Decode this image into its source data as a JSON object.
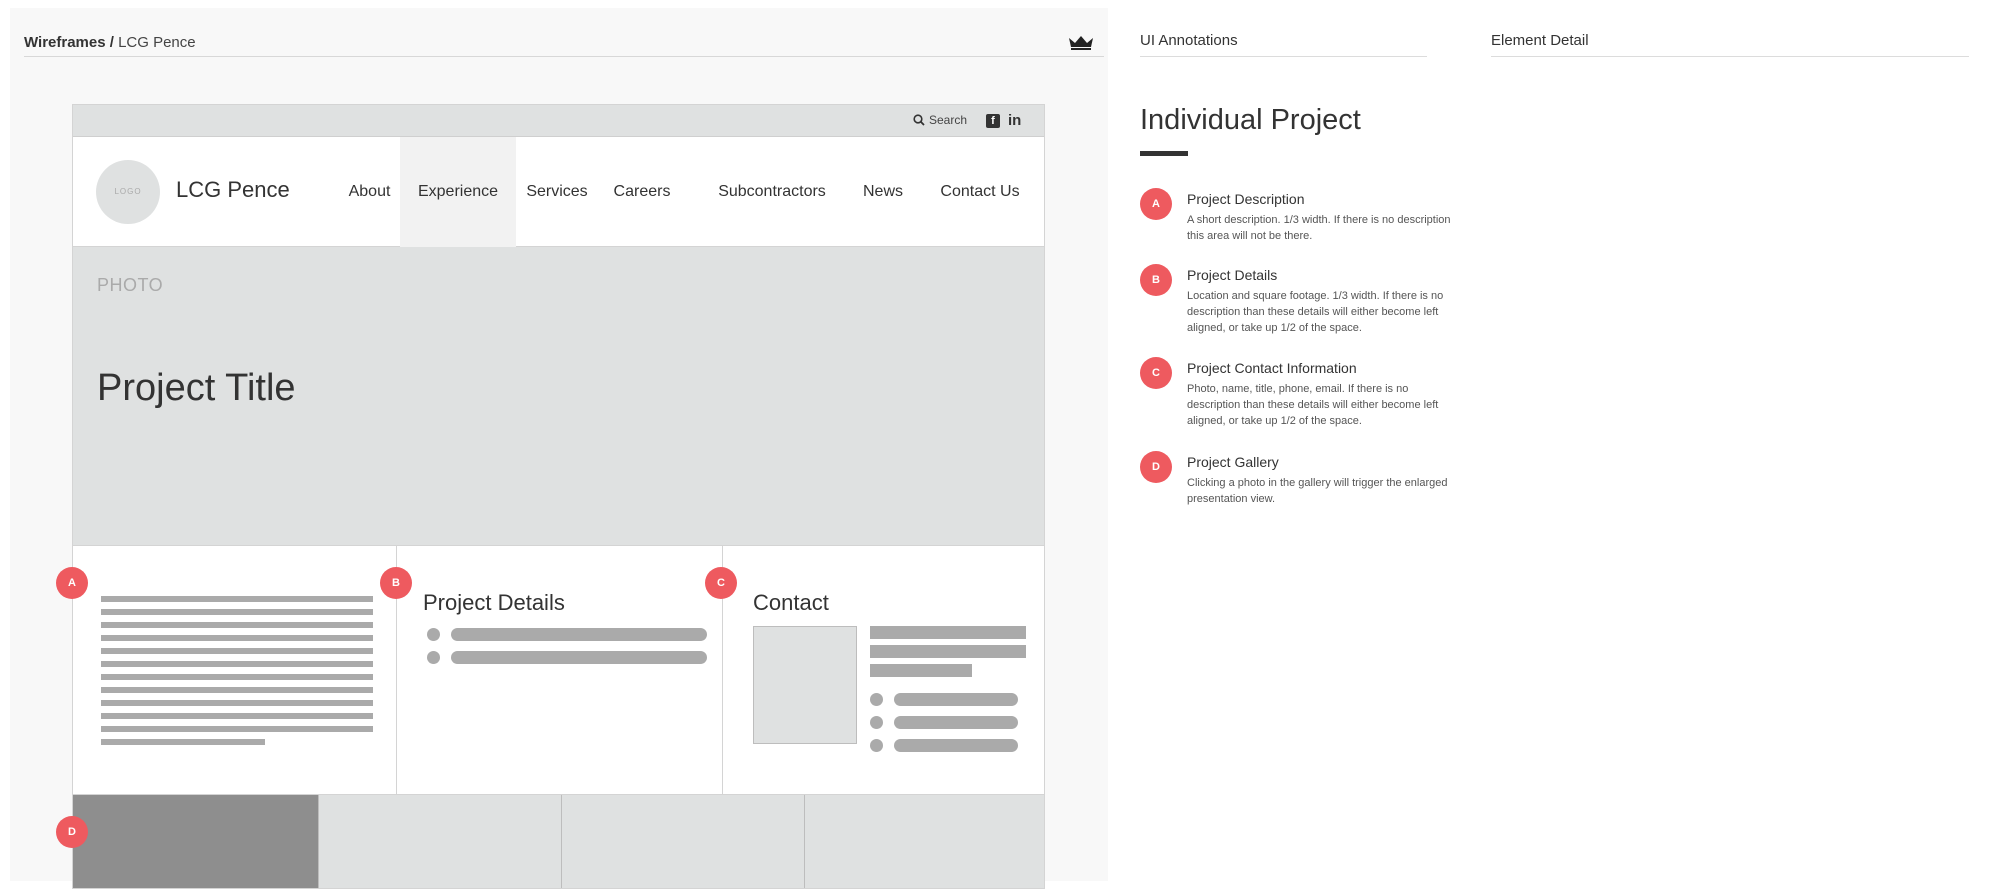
{
  "breadcrumb": {
    "root": "Wireframes /",
    "current": "LCG Pence"
  },
  "wireframe": {
    "topbar": {
      "search_label": "Search",
      "facebook_icon": "facebook-icon",
      "linkedin_label": "in"
    },
    "header": {
      "logo_text": "LOGO",
      "brand": "LCG Pence",
      "nav": [
        "About",
        "Experience",
        "Services",
        "Careers",
        "Subcontractors",
        "News",
        "Contact Us"
      ],
      "active_nav": "Experience"
    },
    "hero": {
      "photo_label": "PHOTO",
      "title": "Project Title"
    },
    "details": {
      "heading": "Project Details"
    },
    "contact": {
      "heading": "Contact"
    },
    "badges": {
      "a": "A",
      "b": "B",
      "c": "C",
      "d": "D"
    }
  },
  "panel": {
    "ui_annotations": "UI Annotations",
    "element_detail": "Element Detail",
    "title": "Individual Project",
    "items": [
      {
        "badge": "A",
        "title": "Project Description",
        "desc": "A short description. 1/3 width. If there is no description this area will not be there."
      },
      {
        "badge": "B",
        "title": "Project Details",
        "desc": "Location and square footage. 1/3 width. If there is no description than these details will either become left aligned, or take up 1/2 of the space."
      },
      {
        "badge": "C",
        "title": "Project Contact Information",
        "desc": "Photo, name, title, phone, email. If there is no description than these details will either become left aligned, or take up 1/2 of the space."
      },
      {
        "badge": "D",
        "title": "Project Gallery",
        "desc": "Clicking a photo in the gallery will trigger the enlarged presentation view."
      }
    ]
  },
  "colors": {
    "badge": "#ee5a5f",
    "placeholder": "#dfe1e1",
    "line": "#aaaaaa"
  }
}
